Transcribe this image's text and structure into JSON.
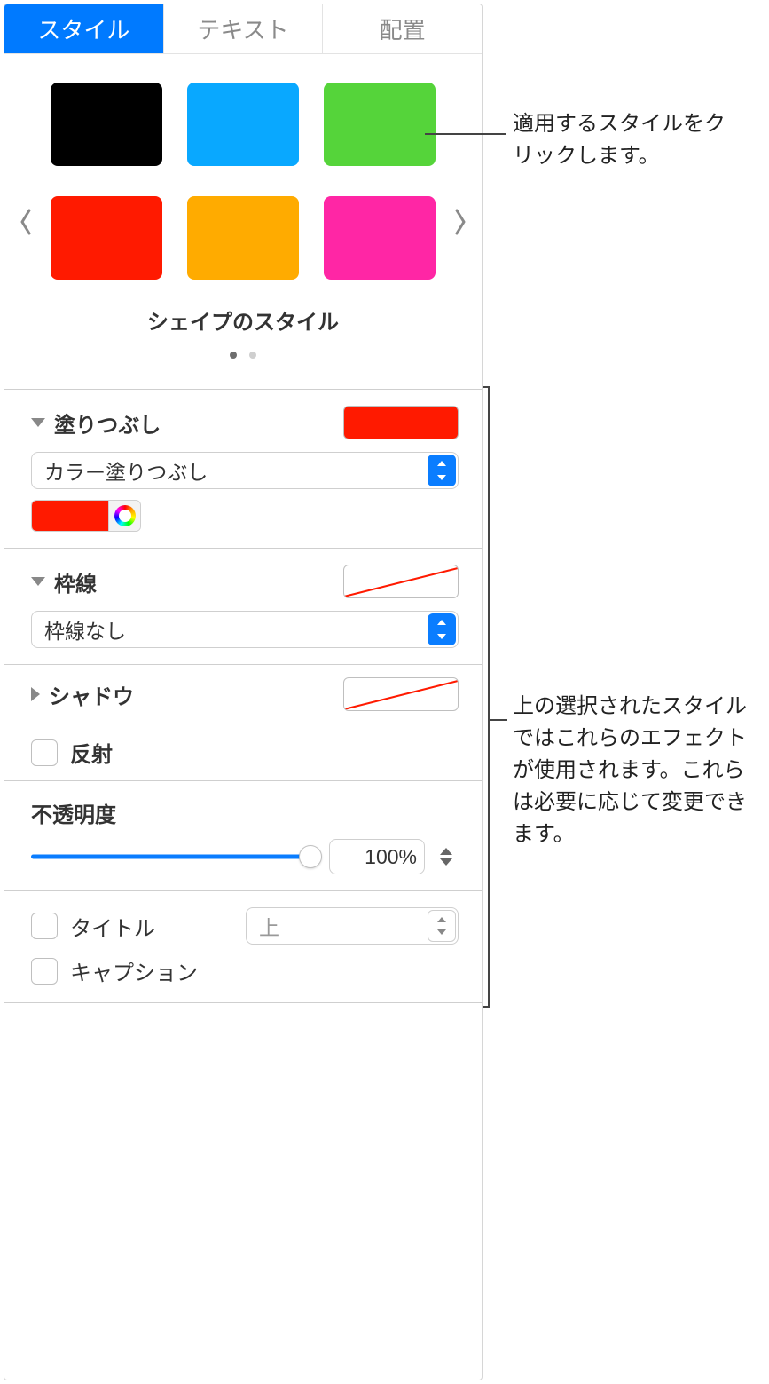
{
  "tabs": {
    "style": "スタイル",
    "text": "テキスト",
    "arrange": "配置"
  },
  "presets": {
    "title": "シェイプのスタイル",
    "colors": [
      "#000000",
      "#09a8ff",
      "#55d43a",
      "#ff1a00",
      "#ffab00",
      "#ff26a5"
    ]
  },
  "fill": {
    "label": "塗りつぶし",
    "mode": "カラー塗りつぶし"
  },
  "border": {
    "label": "枠線",
    "mode": "枠線なし"
  },
  "shadow": {
    "label": "シャドウ"
  },
  "reflect": {
    "label": "反射"
  },
  "opacity": {
    "label": "不透明度",
    "value": "100%"
  },
  "title_row": {
    "label": "タイトル",
    "position": "上"
  },
  "caption_row": {
    "label": "キャプション"
  },
  "callouts": {
    "top": "適用するスタイルをクリックします。",
    "bottom": "上の選択されたスタイルではこれらのエフェクトが使用されます。これらは必要に応じて変更できます。"
  }
}
